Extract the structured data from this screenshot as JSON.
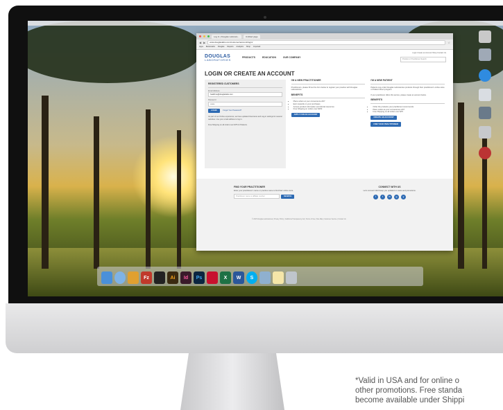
{
  "browser": {
    "tabs": [
      "Log In | Douglas Laborato...",
      "Untitled page"
    ],
    "url": "www.douglaslabs.com/customer/account/login/",
    "bookmarks": [
      "Apps",
      "Bookmarks",
      "Douglas",
      "Reports",
      "Analytics",
      "Shop",
      "Imported"
    ]
  },
  "site": {
    "logo_main": "DOUGLAS",
    "logo_sub": "LABORATORIES",
    "nav": [
      "PRODUCTS",
      "EDUCATION",
      "OUR COMPANY"
    ],
    "util_links": "Login  Create an Account  Shop  Contact Us",
    "search_placeholder": "Product or Practitioner Search",
    "page_title": "LOGIN OR CREATE AN ACCOUNT",
    "registered": {
      "heading": "REGISTERED CUSTOMERS",
      "email_label": "Email Address",
      "email_value": "healthme@douglaslabs.com",
      "password_label": "Password",
      "password_value": "•••••••",
      "login_button": "LOGIN",
      "forgot_link": "Forgot Your Password?",
      "note": "As part of our Online experience, we have updated Username and Log-in settings for several websites. Use your email address to log in.",
      "shipping_note": "Free Shipping on all orders over $75 for Patients."
    },
    "practitioner": {
      "heading": "I'M A NEW PRACTITIONER",
      "intro": "Practitioners, please fill out the form below to register your practice with Douglas Laboratories.",
      "benefits_heading": "BENEFITS",
      "benefits": [
        "Place orders at your convenience 24/7",
        "Earn rewards on your purchases",
        "Access product information and clinical resources",
        "Free Shipping on orders over $150"
      ],
      "apply_button": "APPLY FOR AN ACCOUNT"
    },
    "patient": {
      "heading": "I'M A NEW PATIENT",
      "intro": "Patients may order Douglas Laboratories products through their practitioner's online store or Patient Direct program.",
      "extra": "If your practitioner offers this service, please create an account below.",
      "benefits_heading": "BENEFITS",
      "benefits": [
        "Order the products your practitioner recommends",
        "Place orders at your convenience 24/7",
        "Free Shipping on all orders over $75"
      ],
      "create_button": "CREATE AN ACCOUNT",
      "find_button": "FIND YOUR PRACTITIONER"
    },
    "footer": {
      "find_heading": "FIND YOUR PRACTITIONER",
      "find_text": "Enter your practitioner's name or practice name to find their online store.",
      "find_placeholder": "Practitioner name or affiliate number",
      "search_button": "SEARCH",
      "connect_heading": "CONNECT WITH US",
      "connect_text": "Let's connect! We'll keep you updated on news and promotions.",
      "socials": [
        "f",
        "t",
        "in",
        "g",
        "y"
      ],
      "links": "© 2015 Douglas Laboratories  |  Privacy Policy  |  California Transparency Act  |  Terms of Use  |  Site Map  |  Customer Service  |  Contact Us"
    }
  },
  "dock": [
    "Finder",
    "Safari",
    "Photos",
    "FileZilla",
    "Terminal",
    "Ai",
    "Id",
    "Ps",
    "Acrobat",
    "Excel",
    "Word",
    "Skype",
    "Preview",
    "Notes",
    "Trash"
  ],
  "disclaimer": {
    "line1": "*Valid in USA and for online o",
    "line2": "other promotions. Free standa",
    "line3": "become available under Shippi"
  }
}
